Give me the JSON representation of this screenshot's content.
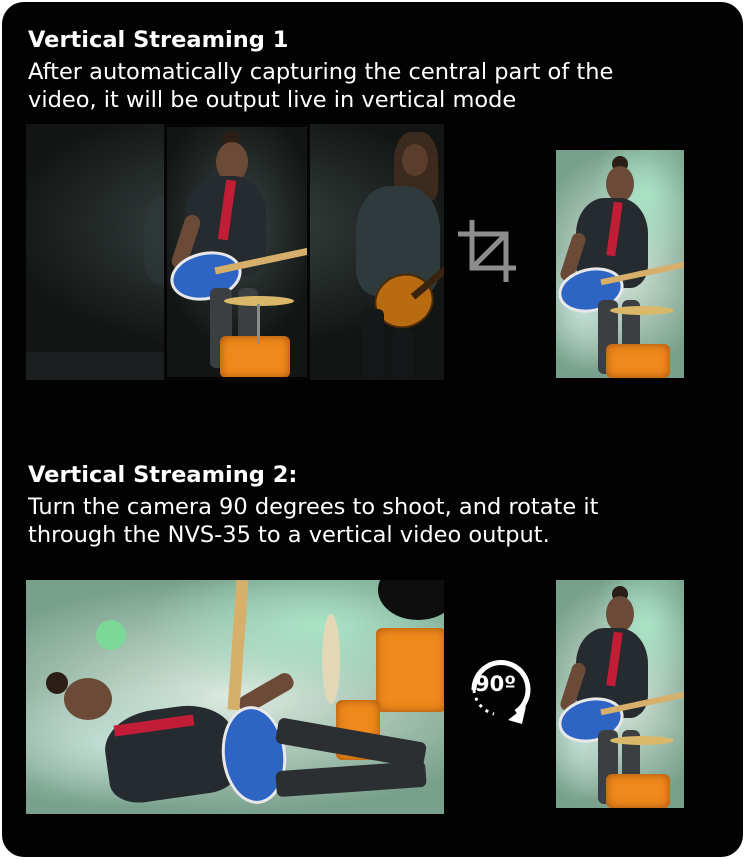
{
  "section1": {
    "title": "Vertical Streaming 1",
    "description_lines": [
      "After automatically capturing the central part of the",
      "video, it will be output live in vertical mode"
    ]
  },
  "section2": {
    "title": "Vertical Streaming 2:",
    "description_lines": [
      "Turn the camera 90 degrees to shoot, and rotate it",
      "through the NVS-35 to a vertical video output."
    ],
    "rotate_label": "90º"
  },
  "icons": {
    "crop": "crop-icon",
    "rotate": "rotate-90-icon"
  },
  "colors": {
    "panel_background": "#020202",
    "text": "#ffffff",
    "guitar": "#2e64c4",
    "drum": "#f08a1c",
    "smoke_green": "#aae6c8"
  }
}
